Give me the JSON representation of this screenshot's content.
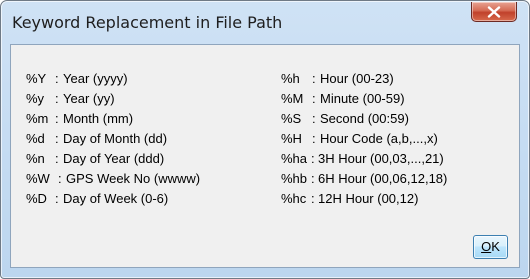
{
  "window": {
    "title": "Keyword Replacement in File Path",
    "close_icon": "close-icon"
  },
  "left_column": [
    {
      "code": "%Y",
      "sep": ":",
      "desc": "Year (yyyy)"
    },
    {
      "code": "%y",
      "sep": ":",
      "desc": "Year (yy)"
    },
    {
      "code": "%m",
      "sep": ":",
      "desc": "Month (mm)"
    },
    {
      "code": "%d",
      "sep": ":",
      "desc": "Day of Month (dd)"
    },
    {
      "code": "%n",
      "sep": ":",
      "desc": "Day of Year (ddd)"
    },
    {
      "code": "%W",
      "sep": ":",
      "desc": "GPS Week No (wwww)"
    },
    {
      "code": "%D",
      "sep": ":",
      "desc": "Day of Week (0-6)"
    }
  ],
  "right_column": [
    {
      "code": "%h",
      "sep": ":",
      "desc": "Hour (00-23)"
    },
    {
      "code": "%M",
      "sep": ":",
      "desc": "Minute (00-59)"
    },
    {
      "code": "%S",
      "sep": ":",
      "desc": "Second (00:59)"
    },
    {
      "code": "%H",
      "sep": ":",
      "desc": "Hour Code (a,b,...,x)"
    },
    {
      "code": "%ha",
      "sep": ":",
      "desc": "3H Hour (00,03,...,21)"
    },
    {
      "code": "%hb",
      "sep": ":",
      "desc": "6H Hour (00,06,12,18)"
    },
    {
      "code": "%hc",
      "sep": ":",
      "desc": "12H Hour (00,12)"
    }
  ],
  "buttons": {
    "ok_mnemonic": "O",
    "ok_rest": "K"
  },
  "colors": {
    "frame": "#bcd6ef",
    "client": "#f0f0f0",
    "close_button": "#c7452f",
    "ok_button": "#bee6fd"
  }
}
